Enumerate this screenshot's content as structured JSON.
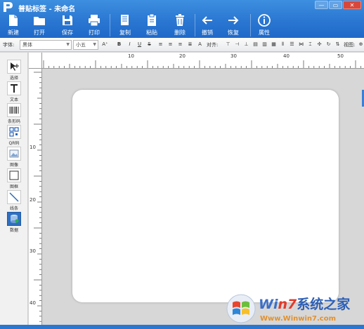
{
  "window": {
    "title": "普贴标签 - 未命名",
    "controls": {
      "minimize": "—",
      "maximize": "▭",
      "close": "✕"
    }
  },
  "ribbon": {
    "tools": [
      {
        "label": "新建",
        "icon": "new-file-icon"
      },
      {
        "label": "打开",
        "icon": "folder-open-icon"
      },
      {
        "label": "保存",
        "icon": "save-disk-icon"
      },
      {
        "label": "打印",
        "icon": "printer-icon"
      },
      {
        "label": "复制",
        "icon": "copy-icon"
      },
      {
        "label": "粘贴",
        "icon": "paste-icon"
      },
      {
        "label": "删除",
        "icon": "trash-icon"
      },
      {
        "label": "撤销",
        "icon": "undo-arrow-icon"
      },
      {
        "label": "恢复",
        "icon": "redo-arrow-icon"
      },
      {
        "label": "属性",
        "icon": "info-icon"
      }
    ]
  },
  "format_bar": {
    "font_label": "字体:",
    "font_value": "黑体",
    "size_value": "小五",
    "align_label": "对齐:",
    "view_label": "视图:",
    "style_buttons": [
      "A⁺",
      "B",
      "I",
      "U",
      "S"
    ],
    "letter_a": "A"
  },
  "left_tools": [
    {
      "label": "选择",
      "icon": "select-arrow-icon"
    },
    {
      "label": "文本",
      "icon": "text-t-icon"
    },
    {
      "label": "条形码",
      "icon": "barcode-icon"
    },
    {
      "label": "QR码",
      "icon": "qr-code-icon"
    },
    {
      "label": "图像",
      "icon": "image-icon"
    },
    {
      "label": "图框",
      "icon": "rectangle-frame-icon"
    },
    {
      "label": "线条",
      "icon": "line-icon"
    },
    {
      "label": "数据",
      "icon": "database-icon",
      "active": true
    }
  ],
  "rulers": {
    "horizontal": [
      "10",
      "20",
      "30",
      "40",
      "50"
    ],
    "vertical": [
      "10",
      "20",
      "30",
      "40"
    ]
  },
  "watermark": {
    "brand_prefix": "Wi",
    "brand_seven": "n7",
    "brand_cn": "系统之家",
    "url": "Www.Winwin7.com"
  },
  "colors": {
    "accent": "#2a77d2",
    "active_tool": "#2f6fc1"
  }
}
